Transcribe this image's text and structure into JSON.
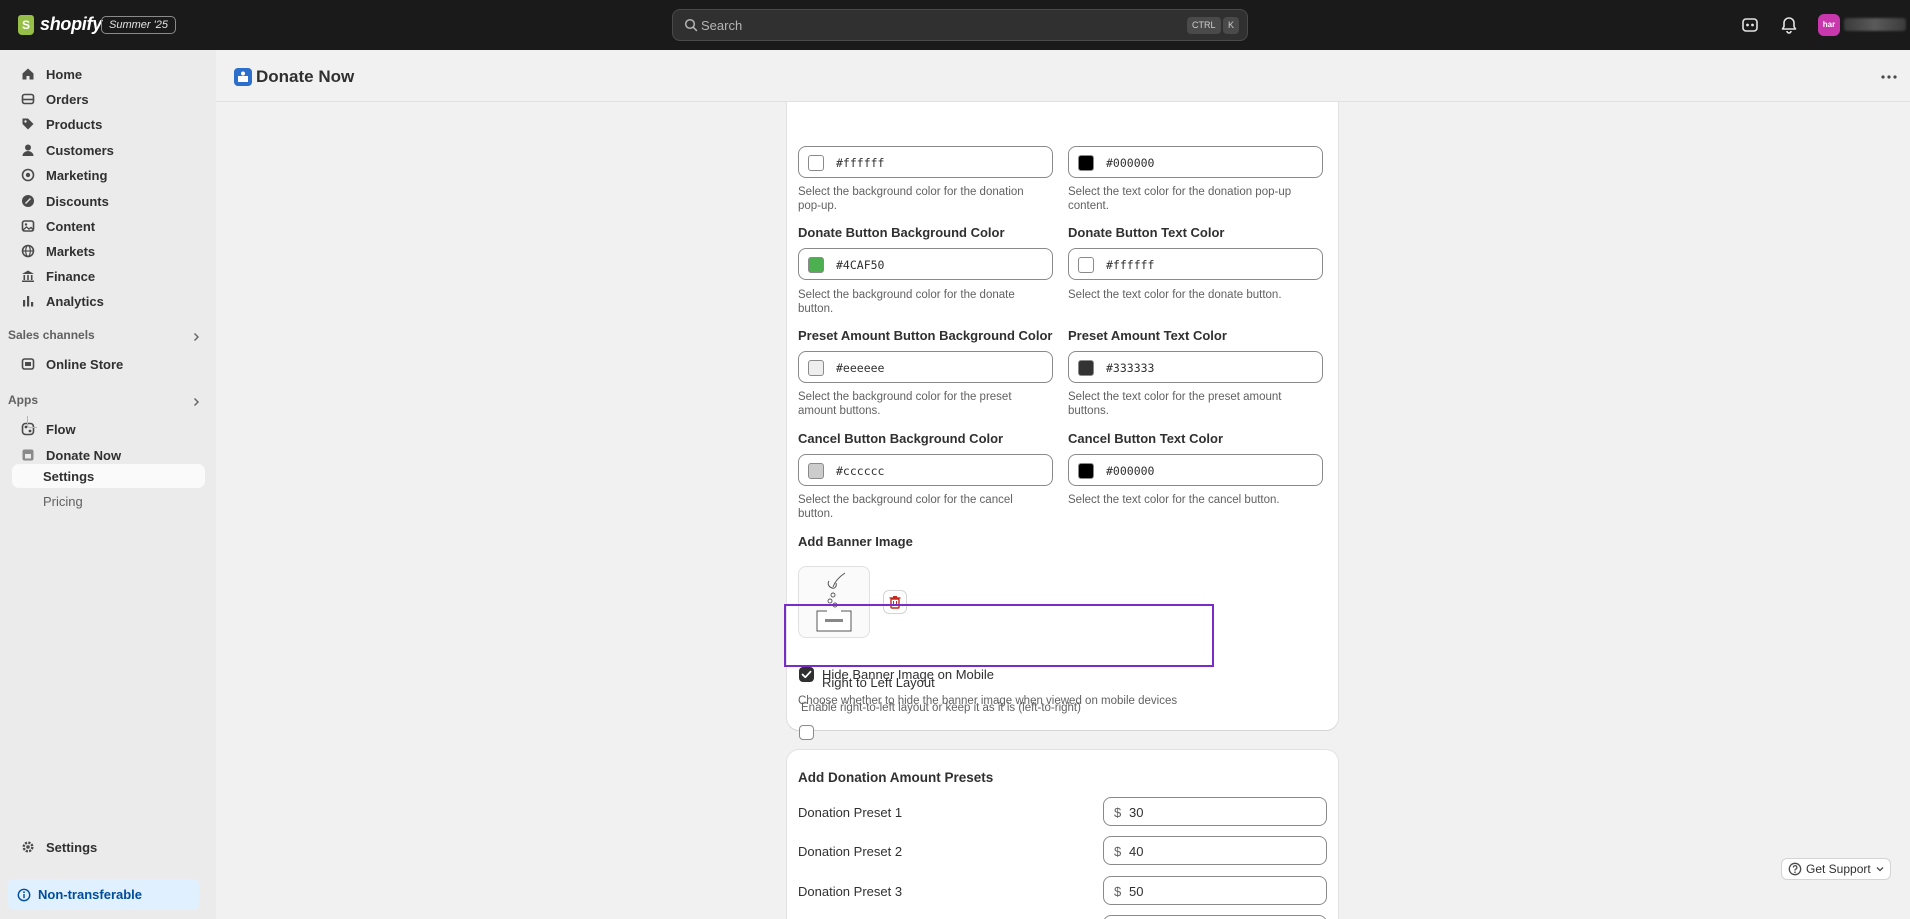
{
  "topbar": {
    "brand": "shopify",
    "edition_badge": "Summer '25",
    "search_placeholder": "Search",
    "shortcut_ctrl": "CTRL",
    "shortcut_k": "K",
    "avatar_initials": "har"
  },
  "sidebar": {
    "nav": [
      {
        "label": "Home",
        "icon": "home-icon"
      },
      {
        "label": "Orders",
        "icon": "orders-icon"
      },
      {
        "label": "Products",
        "icon": "tag-icon"
      },
      {
        "label": "Customers",
        "icon": "person-icon"
      },
      {
        "label": "Marketing",
        "icon": "target-icon"
      },
      {
        "label": "Discounts",
        "icon": "discount-icon"
      },
      {
        "label": "Content",
        "icon": "content-icon"
      },
      {
        "label": "Markets",
        "icon": "globe-icon"
      },
      {
        "label": "Finance",
        "icon": "bank-icon"
      },
      {
        "label": "Analytics",
        "icon": "bar-chart-icon"
      }
    ],
    "sales_channels_label": "Sales channels",
    "online_store": "Online Store",
    "apps_label": "Apps",
    "flow": "Flow",
    "donate_now": "Donate Now",
    "settings_sub": "Settings",
    "pricing_sub": "Pricing",
    "settings": "Settings",
    "non_transferable": "Non-transferable"
  },
  "page": {
    "title": "Donate Now"
  },
  "colors_card": {
    "popup_bg": {
      "value": "#ffffff",
      "swatch": "#ffffff",
      "help": "Select the background color for the donation pop-up."
    },
    "popup_text": {
      "value": "#000000",
      "swatch": "#000000",
      "help": "Select the text color for the donation pop-up content."
    },
    "donate_bg": {
      "label": "Donate Button Background Color",
      "value": "#4CAF50",
      "swatch": "#4CAF50",
      "help": "Select the background color for the donate button."
    },
    "donate_text": {
      "label": "Donate Button Text Color",
      "value": "#ffffff",
      "swatch": "#ffffff",
      "help": "Select the text color for the donate button."
    },
    "preset_bg": {
      "label": "Preset Amount Button Background Color",
      "value": "#eeeeee",
      "swatch": "#eeeeee",
      "help": "Select the background color for the preset amount buttons."
    },
    "preset_text": {
      "label": "Preset Amount Text Color",
      "value": "#333333",
      "swatch": "#333333",
      "help": "Select the text color for the preset amount buttons."
    },
    "cancel_bg": {
      "label": "Cancel Button Background Color",
      "value": "#cccccc",
      "swatch": "#cccccc",
      "help": "Select the background color for the cancel button."
    },
    "cancel_text": {
      "label": "Cancel Button Text Color",
      "value": "#000000",
      "swatch": "#000000",
      "help": "Select the text color for the cancel button."
    },
    "banner_label": "Add Banner Image",
    "hide_banner_label": "Hide Banner Image on Mobile",
    "hide_banner_checked": true,
    "hide_banner_help": "Choose whether to hide the banner image when viewed on mobile devices",
    "rtl_label": "Right to Left Layout",
    "rtl_checked": false,
    "rtl_help": "Enable right-to-left layout or keep it as it is (left-to-right)"
  },
  "presets_card": {
    "title": "Add Donation Amount Presets",
    "currency": "$",
    "presets": [
      {
        "label": "Donation Preset 1",
        "value": "30"
      },
      {
        "label": "Donation Preset 2",
        "value": "40"
      },
      {
        "label": "Donation Preset 3",
        "value": "50"
      }
    ]
  },
  "support": {
    "label": "Get Support"
  }
}
